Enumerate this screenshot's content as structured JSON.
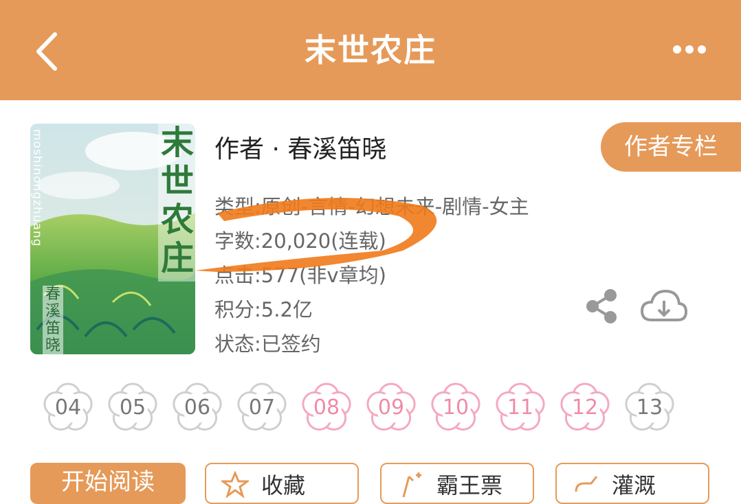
{
  "header": {
    "title": "末世农庄",
    "back_icon": "chevron-left-icon",
    "more_icon": "more-horizontal-icon",
    "background": "#e59a59"
  },
  "book": {
    "cover": {
      "title_text": "末世农庄",
      "author_text": "春溪笛晓",
      "pinyin_text": "moshinongzhuang"
    },
    "author_label": "作者 · 春溪笛晓",
    "author_column_button": "作者专栏",
    "meta": [
      "类型:原创-言情-幻想未来-剧情-女主",
      "字数:20,020(连载)",
      "点击:577(非v章均)",
      "积分:5.2亿",
      "状态:已签约"
    ],
    "share_icon": "share-icon",
    "download_icon": "cloud-download-icon"
  },
  "chapters": [
    {
      "label": "04",
      "highlighted": false
    },
    {
      "label": "05",
      "highlighted": false
    },
    {
      "label": "06",
      "highlighted": false
    },
    {
      "label": "07",
      "highlighted": false
    },
    {
      "label": "08",
      "highlighted": true
    },
    {
      "label": "09",
      "highlighted": true
    },
    {
      "label": "10",
      "highlighted": true
    },
    {
      "label": "11",
      "highlighted": true
    },
    {
      "label": "12",
      "highlighted": true
    },
    {
      "label": "13",
      "highlighted": false
    }
  ],
  "actions": {
    "start_reading": "开始阅读",
    "favorite": "收藏",
    "bawang_ticket": "霸王票",
    "irrigate": "灌溉"
  },
  "colors": {
    "accent": "#e59a59",
    "pink": "#f08aa8",
    "brush": "#f07a1a"
  }
}
